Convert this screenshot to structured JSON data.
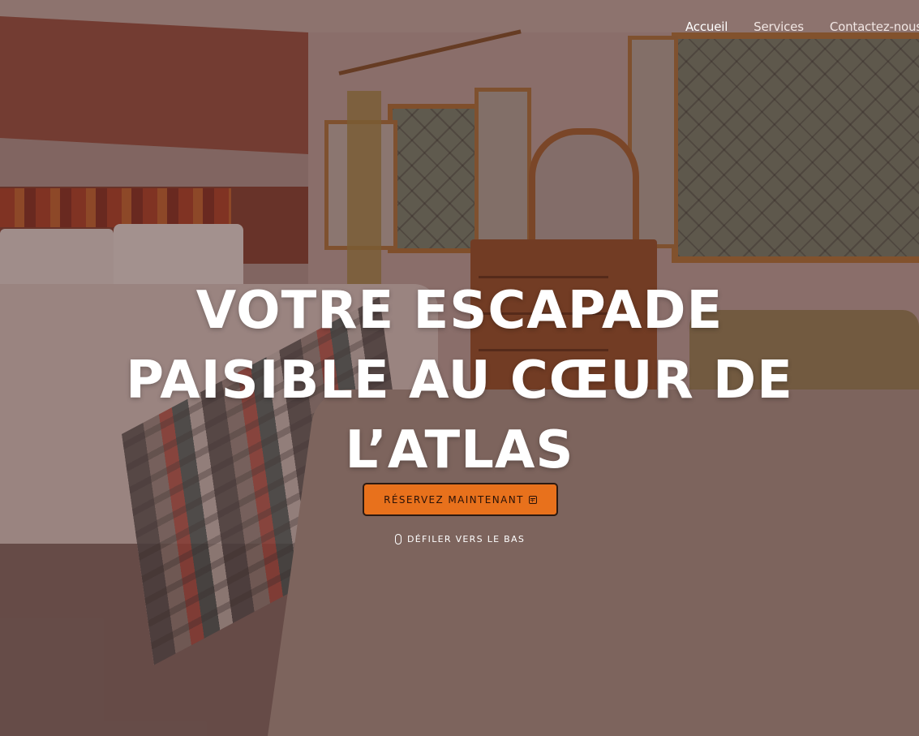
{
  "nav": {
    "items": [
      {
        "label": "Accueil",
        "active": true
      },
      {
        "label": "Services",
        "active": false
      },
      {
        "label": "Contactez-nous",
        "active": false
      }
    ]
  },
  "hero": {
    "title_lines": [
      "VOTRE ESCAPADE",
      "PAISIBLE AU CŒUR DE",
      "L’ATLAS"
    ],
    "cta_label": "RÉSERVEZ MAINTENANT",
    "cta_icon": "calendar-plus-icon",
    "scroll_label": "DÉFILER VERS LE BAS",
    "scroll_icon": "mouse-icon"
  },
  "colors": {
    "accent": "#e8711c",
    "text": "#ffffff",
    "overlay": "rgba(70,40,38,0.38)"
  }
}
